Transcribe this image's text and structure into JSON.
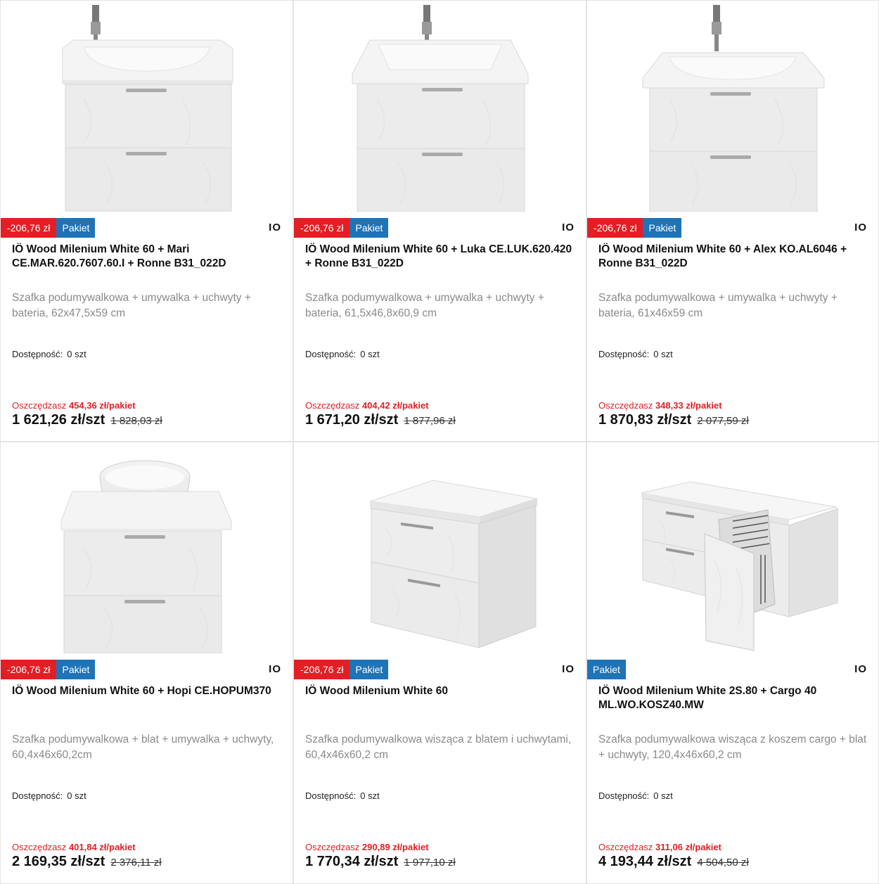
{
  "products": [
    {
      "discount": "-206,76 zł",
      "badge": "Pakiet",
      "brand": "IO",
      "title": "IÖ Wood Milenium White 60 + Mari CE.MAR.620.7607.60.I + Ronne B31_022D",
      "desc": "Szafka podumywalkowa + umywalka + uchwyty + bateria, 62x47,5x59 cm",
      "avail_label": "Dostępność:",
      "avail_value": "0 szt",
      "save_label": "Oszczędzasz",
      "save_value": "454,36 zł/pakiet",
      "price": "1 621,26 zł/szt",
      "old_price": "1 828,03 zł",
      "image": "cabinet-basin-faucet"
    },
    {
      "discount": "-206,76 zł",
      "badge": "Pakiet",
      "brand": "IO",
      "title": "IÖ Wood Milenium White 60 + Luka CE.LUK.620.420 + Ronne B31_022D",
      "desc": "Szafka podumywalkowa + umywalka + uchwyty + bateria, 61,5x46,8x60,9 cm",
      "avail_label": "Dostępność:",
      "avail_value": "0 szt",
      "save_label": "Oszczędzasz",
      "save_value": "404,42 zł/pakiet",
      "price": "1 671,20 zł/szt",
      "old_price": "1 877,96 zł",
      "image": "cabinet-basin-faucet"
    },
    {
      "discount": "-206,76 zł",
      "badge": "Pakiet",
      "brand": "IO",
      "title": "IÖ Wood Milenium White 60 + Alex KO.AL6046 + Ronne B31_022D",
      "desc": "Szafka podumywalkowa + umywalka + uchwyty + bateria, 61x46x59 cm",
      "avail_label": "Dostępność:",
      "avail_value": "0 szt",
      "save_label": "Oszczędzasz",
      "save_value": "348,33 zł/pakiet",
      "price": "1 870,83 zł/szt",
      "old_price": "2 077,59 zł",
      "image": "cabinet-basin-faucet"
    },
    {
      "discount": "-206,76 zł",
      "badge": "Pakiet",
      "brand": "IO",
      "title": "IÖ Wood Milenium White 60 + Hopi CE.HOPUM370",
      "desc": "Szafka podumywalkowa + blat + umywalka + uchwyty, 60,4x46x60,2cm",
      "avail_label": "Dostępność:",
      "avail_value": "0 szt",
      "save_label": "Oszczędzasz",
      "save_value": "401,84 zł/pakiet",
      "price": "2 169,35 zł/szt",
      "old_price": "2 376,11 zł",
      "image": "cabinet-bowl"
    },
    {
      "discount": "-206,76 zł",
      "badge": "Pakiet",
      "brand": "IO",
      "title": "IÖ Wood Milenium White 60",
      "desc": "Szafka podumywalkowa wisząca z blatem i uchwytami, 60,4x46x60,2 cm",
      "avail_label": "Dostępność:",
      "avail_value": "0 szt",
      "save_label": "Oszczędzasz",
      "save_value": "290,89 zł/pakiet",
      "price": "1 770,34 zł/szt",
      "old_price": "1 977,10 zł",
      "image": "cabinet-angled"
    },
    {
      "discount": "",
      "badge": "Pakiet",
      "brand": "IO",
      "title": "IÖ Wood Milenium White 2S.80 + Cargo 40 ML.WO.KOSZ40.MW",
      "desc": "Szafka podumywalkowa wisząca z koszem cargo + blat + uchwyty, 120,4x46x60,2 cm",
      "avail_label": "Dostępność:",
      "avail_value": "0 szt",
      "save_label": "Oszczędzasz",
      "save_value": "311,06 zł/pakiet",
      "price": "4 193,44 zł/szt",
      "old_price": "4 504,50 zł",
      "image": "cabinet-cargo"
    }
  ]
}
